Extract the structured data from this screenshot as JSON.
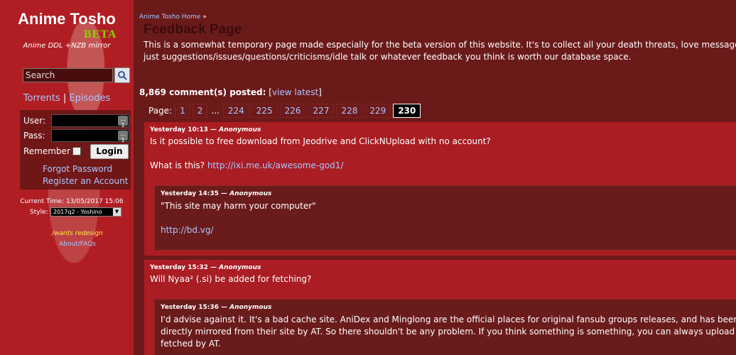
{
  "sidebar": {
    "logo_title": "Anime Tosho",
    "logo_beta": "BETA",
    "tagline": "Anime DDL +NZB mirror",
    "search_placeholder": "Search",
    "nav": {
      "torrents": "Torrents",
      "separator": "|",
      "episodes": "Episodes"
    },
    "login": {
      "user_label": "User:",
      "pass_label": "Pass:",
      "remember_label": "Remember",
      "login_button": "Login",
      "forgot_password": "Forgot Password",
      "register": "Register an Account"
    },
    "current_time": "Current Time: 13/05/2017 15:06",
    "style_label": "Style:",
    "style_value": "2017q2 - Yoshino",
    "wants_redesign": "/wants redesign",
    "about_faqs": "About/FAQs"
  },
  "main": {
    "breadcrumb_home": "Anime Tosho Home",
    "breadcrumb_sep": "»",
    "page_title": "Feedback Page",
    "intro_line1": "This is a somewhat temporary page made especially for the beta version of this website. It's to collect all your death threats, love messages, requ",
    "intro_line2": "just suggestions/issues/questions/criticisms/idle talk or whatever feedback you think is worth our database space.",
    "comment_count": "8,869 comment(s) posted:",
    "view_latest_open": "[",
    "view_latest": "view latest",
    "view_latest_close": "]",
    "pager_label": "Page:",
    "pages_start": [
      "1",
      "2"
    ],
    "pages_ellipsis": "...",
    "pages_end": [
      "224",
      "225",
      "226",
      "227",
      "228",
      "229"
    ],
    "page_current": "230"
  },
  "comments": [
    {
      "time": "Yesterday 10:13",
      "dash": "—",
      "author": "Anonymous",
      "line1": "Is it possible to free download from Jeodrive and ClickNUpload with no account?",
      "line2_prefix": "What is this? ",
      "line2_link": "http://ixi.me.uk/awesome-god1/",
      "reply": {
        "time": "Yesterday 14:35",
        "dash": "—",
        "author": "Anonymous",
        "line1": "\"This site may harm your computer\"",
        "link": "http://bd.vg/"
      }
    },
    {
      "time": "Yesterday 15:32",
      "dash": "—",
      "author": "Anonymous",
      "line1": "Will Nyaa² (.si) be added for fetching?",
      "reply": {
        "time": "Yesterday 15:36",
        "dash": "—",
        "author": "Anonymous",
        "line1": "I'd advise against it. It's a bad cache site. AniDex and Minglong are the official places for original fansub groups releases, and has been in the",
        "line2": "directly mirrored from their site by AT. So there shouldn't be any problem. If you think something is something, you can always upload it to To",
        "line3": "fetched by AT."
      }
    }
  ],
  "icons": {
    "search": "magnifier-icon",
    "field_helper": "ellipsis-icon",
    "dropdown": "chevron-down-icon"
  },
  "colors": {
    "sidebar_bg": "#b01e24",
    "main_bg": "#6b1a1a",
    "comment_bg": "#a91d23",
    "link": "#a9c7ff",
    "beta": "#8bd200"
  }
}
